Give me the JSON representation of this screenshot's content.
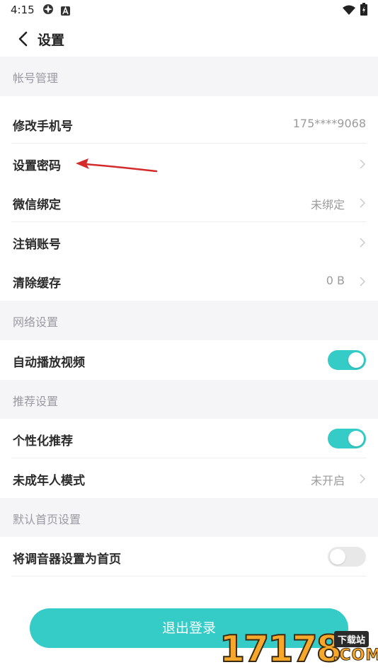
{
  "status_bar": {
    "time": "4:15"
  },
  "nav": {
    "title": "设置"
  },
  "groups": {
    "account": {
      "header": "帐号管理",
      "change_phone": {
        "label": "修改手机号",
        "value": "175****9068"
      },
      "set_password": {
        "label": "设置密码"
      },
      "wechat_bind": {
        "label": "微信绑定",
        "value": "未绑定"
      },
      "cancel_account": {
        "label": "注销账号"
      },
      "clear_cache": {
        "label": "清除缓存",
        "value": "0 B"
      }
    },
    "network": {
      "header": "网络设置",
      "autoplay": {
        "label": "自动播放视频",
        "enabled": true
      }
    },
    "recommend": {
      "header": "推荐设置",
      "personalized": {
        "label": "个性化推荐",
        "enabled": true
      },
      "minor_mode": {
        "label": "未成年人模式",
        "value": "未开启"
      }
    },
    "homepage": {
      "header": "默认首页设置",
      "tuner_home": {
        "label": "将调音器设置为首页",
        "enabled": false
      }
    }
  },
  "logout": {
    "label": "退出登录"
  },
  "watermark": {
    "digits": "17178",
    "badge": "下载站",
    "suffix": ".COM"
  },
  "colors": {
    "accent": "#35cbc6",
    "toggle_off": "#e8e8e8",
    "annotation_arrow": "#d42a2a",
    "section_bg": "#f5f5f7"
  }
}
